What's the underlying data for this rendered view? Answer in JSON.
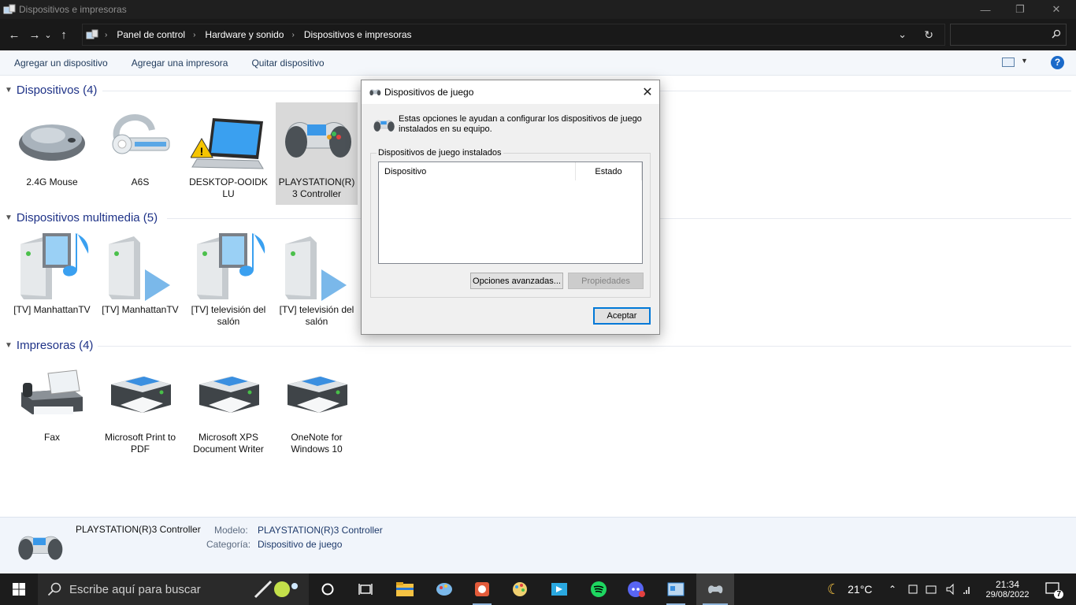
{
  "window": {
    "title": "Dispositivos e impresoras",
    "minimize": "—",
    "maximize": "❐",
    "close": "✕"
  },
  "nav": {
    "back": "←",
    "forward": "→",
    "recent": "⌄",
    "up": "↑",
    "breadcrumbs": [
      "Panel de control",
      "Hardware y sonido",
      "Dispositivos e impresoras"
    ],
    "dropdown": "⌄",
    "refresh": "↻",
    "search_placeholder": ""
  },
  "commands": {
    "add_device": "Agregar un dispositivo",
    "add_printer": "Agregar una impresora",
    "remove_device": "Quitar dispositivo",
    "help": "?"
  },
  "groups": {
    "devices": {
      "title": "Dispositivos (4)",
      "items": [
        "2.4G Mouse",
        "A6S",
        "DESKTOP-OOIDK LU",
        "PLAYSTATION(R) 3 Controller"
      ]
    },
    "multimedia": {
      "title": "Dispositivos multimedia (5)",
      "items": [
        "[TV] ManhattanTV",
        "[TV] ManhattanTV",
        "[TV] televisión del salón",
        "[TV] televisión del salón"
      ]
    },
    "printers": {
      "title": "Impresoras (4)",
      "items": [
        "Fax",
        "Microsoft Print to PDF",
        "Microsoft XPS Document Writer",
        "OneNote for Windows 10"
      ]
    }
  },
  "details": {
    "name": "PLAYSTATION(R)3 Controller",
    "model_label": "Modelo:",
    "model_value": "PLAYSTATION(R)3 Controller",
    "category_label": "Categoría:",
    "category_value": "Dispositivo de juego"
  },
  "dialog": {
    "title": "Dispositivos de juego",
    "intro": "Estas opciones le ayudan a configurar los dispositivos de juego instalados en su equipo.",
    "group_label": "Dispositivos de juego instalados",
    "col_device": "Dispositivo",
    "col_status": "Estado",
    "btn_advanced": "Opciones avanzadas...",
    "btn_properties": "Propiedades",
    "btn_ok": "Aceptar",
    "close": "✕"
  },
  "taskbar": {
    "search_placeholder": "Escribe aquí para buscar",
    "weather": "21°C",
    "time": "21:34",
    "date": "29/08/2022",
    "notifications": "7"
  },
  "colors": {
    "accent": "#0078d7",
    "group_header": "#1e3287",
    "taskbar": "#1c1c1c"
  }
}
